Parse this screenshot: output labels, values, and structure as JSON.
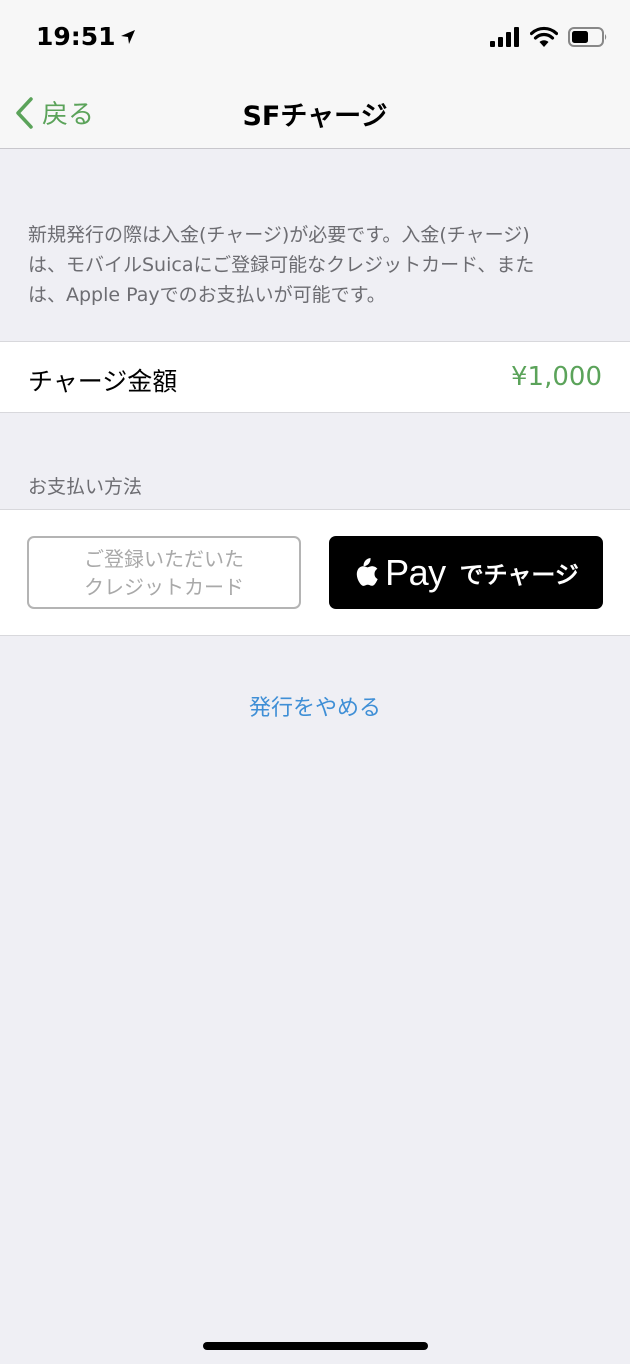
{
  "status_bar": {
    "time": "19:51"
  },
  "nav": {
    "back_label": "戻る",
    "title": "SFチャージ"
  },
  "notice": {
    "line1": "新規発行の際は入金(チャージ)が必要です。入金(チャージ)",
    "line2": "は、モバイルSuicaにご登録可能なクレジットカード、また",
    "line3": "は、Apple Payでのお支払いが可能です。"
  },
  "amount": {
    "label": "チャージ金額",
    "value": "¥1,000"
  },
  "payment": {
    "section_header": "お支払い方法",
    "credit_line1": "ご登録いただいた",
    "credit_line2": "クレジットカード",
    "applepay_pay": "Pay",
    "applepay_suffix": "でチャージ"
  },
  "cancel": {
    "label": "発行をやめる"
  },
  "colors": {
    "accent_green": "#5ba35a",
    "link_blue": "#3f8fd6"
  }
}
